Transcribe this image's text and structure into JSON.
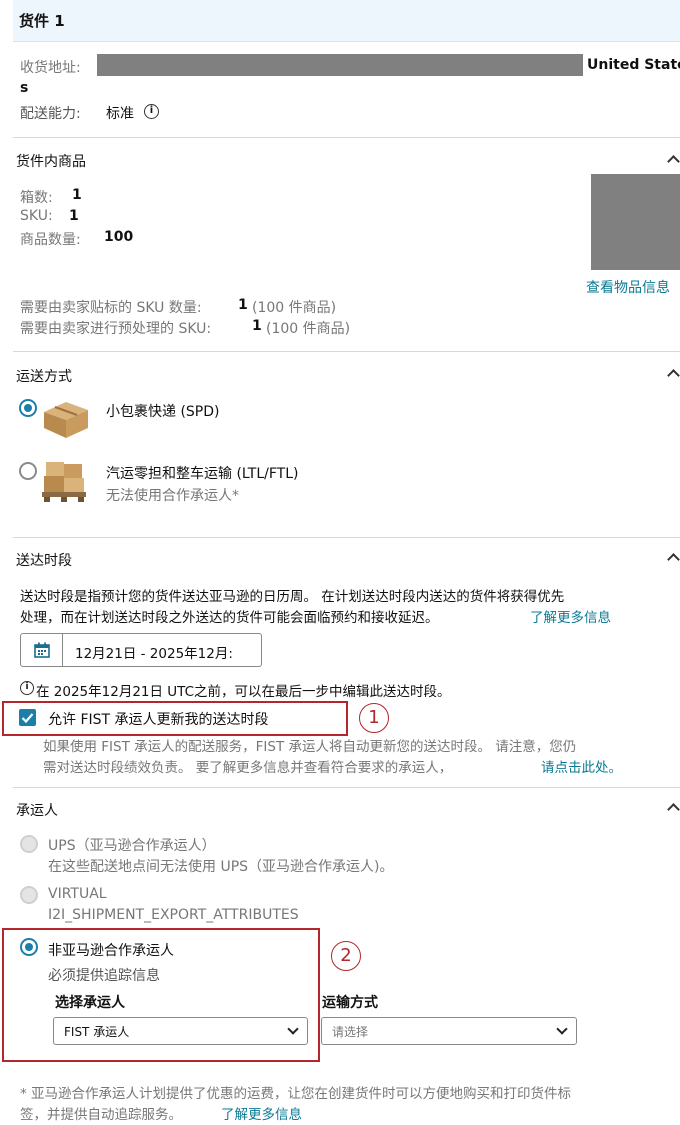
{
  "header": {
    "title": "货件 1"
  },
  "address": {
    "label": "收货地址:",
    "country_part1": "United State",
    "country_part2": "s",
    "capability_label": "配送能力:",
    "capability_value": "标准"
  },
  "items": {
    "title": "货件内商品",
    "boxes_label": "箱数:",
    "boxes_value": "1",
    "sku_label": "SKU:",
    "sku_value": "1",
    "qty_label": "商品数量:",
    "qty_value": "100",
    "view_link": "查看物品信息",
    "label_sku_text": "需要由卖家贴标的 SKU 数量:",
    "label_sku_value": "1",
    "label_sku_paren": "(100 件商品)",
    "prep_sku_text": "需要由卖家进行预处理的 SKU:",
    "prep_sku_value": "1",
    "prep_sku_paren": "(100 件商品)"
  },
  "shipping_mode": {
    "title": "运送方式",
    "options": [
      {
        "label": "小包裹快递 (SPD)",
        "selected": true
      },
      {
        "label": "汽运零担和整车运输 (LTL/FTL)",
        "sub": "无法使用合作承运人*",
        "selected": false
      }
    ]
  },
  "delivery_window": {
    "title": "送达时段",
    "desc_line1": "送达时段是指预计您的货件送达亚马逊的日历周。 在计划送达时段内送达的货件将获得优先",
    "desc_line2": "处理，而在计划送达时段之外送达的货件可能会面临预约和接收延迟。",
    "learn_more": "了解更多信息",
    "date_value": "12月21日 - 2025年12月:",
    "edit_note": "在 2025年12月21日 UTC之前，可以在最后一步中编辑此送达时段。",
    "checkbox_label": "允许 FIST 承运人更新我的送达时段",
    "checkbox_checked": true,
    "note_line1": "如果使用 FIST 承运人的配送服务，FIST 承运人将自动更新您的送达时段。 请注意，您仍",
    "note_line2": "需对送达时段绩效负责。 要了解更多信息并查看符合要求的承运人，",
    "note_link": "请点击此处。"
  },
  "carrier": {
    "title": "承运人",
    "options": [
      {
        "label": "UPS（亚马逊合作承运人）",
        "sub": "在这些配送地点间无法使用 UPS（亚马逊合作承运人)。",
        "disabled": true
      },
      {
        "label": "VIRTUAL",
        "sub": "I2I_SHIPMENT_EXPORT_ATTRIBUTES",
        "disabled": true
      },
      {
        "label": "非亚马逊合作承运人",
        "sub": "必须提供追踪信息",
        "selected": true
      }
    ],
    "select_carrier_label": "选择承运人",
    "select_carrier_value": "FIST 承运人",
    "transport_label": "运输方式",
    "transport_value": "请选择"
  },
  "footer": {
    "line1": "* 亚马逊合作承运人计划提供了优惠的运费，让您在创建货件时可以方便地购买和打印货件标",
    "line2": "签，并提供自动追踪服务。",
    "learn_more": "了解更多信息"
  },
  "annotations": [
    "1",
    "2"
  ],
  "colors": {
    "accent": "#1b7fa8",
    "link": "#0a7a93",
    "annotation": "#b3262b",
    "header_bg": "#eef6fd"
  }
}
